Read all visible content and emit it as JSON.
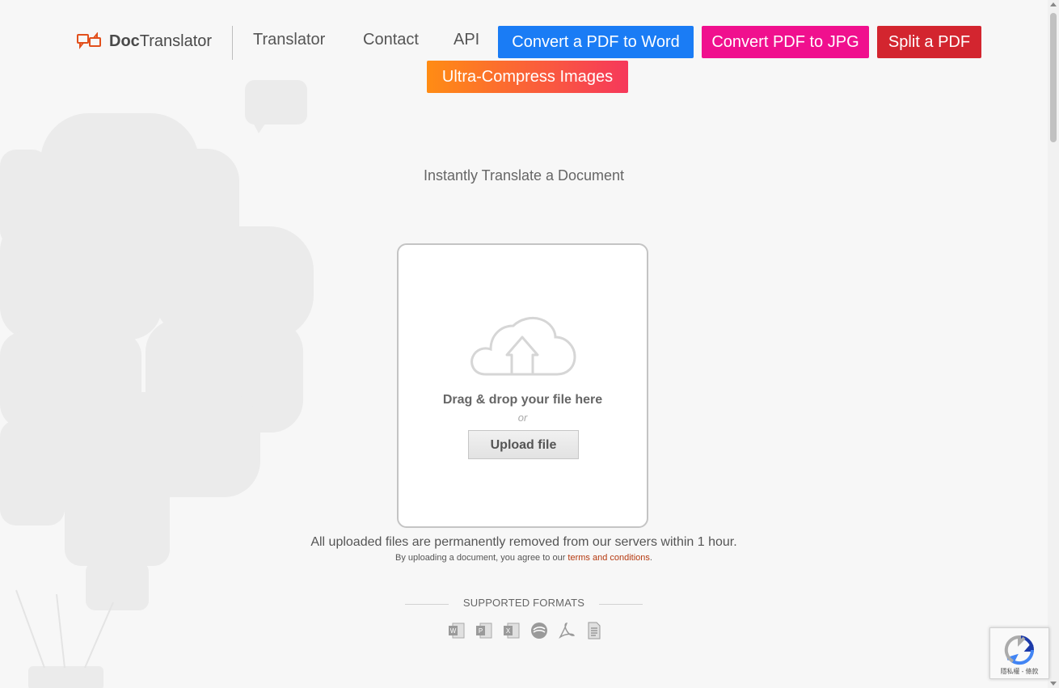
{
  "header": {
    "logo": {
      "bold": "Doc",
      "rest": "Translator"
    },
    "links": [
      "Translator",
      "Contact",
      "API"
    ],
    "buttons": {
      "word": "Convert a PDF to Word",
      "jpg": "Convert PDF to JPG",
      "split": "Split a PDF",
      "compress": "Ultra-Compress Images"
    }
  },
  "main": {
    "subtitle": "Instantly Translate a Document",
    "upload": {
      "drag_text": "Drag & drop your file here",
      "or_text": "or",
      "button_label": "Upload file"
    },
    "notice": "All uploaded files are permanently removed from our servers within 1 hour.",
    "agree_prefix": "By uploading a document, you agree to our ",
    "agree_link": "terms and conditions",
    "agree_suffix": ".",
    "formats_label": "SUPPORTED FORMATS",
    "format_icons": [
      "word-icon",
      "powerpoint-icon",
      "excel-icon",
      "openoffice-icon",
      "pdf-icon",
      "text-icon"
    ]
  },
  "recaptcha": {
    "text": "隱私權 - 條款"
  },
  "colors": {
    "brand": "#e2501c",
    "word_btn": "#1a7cf5",
    "jpg_btn": "#f0108e",
    "split_btn": "#d3252f",
    "compress_gradient": [
      "#ff8c14",
      "#f6385b"
    ],
    "link": "#b53a10"
  }
}
